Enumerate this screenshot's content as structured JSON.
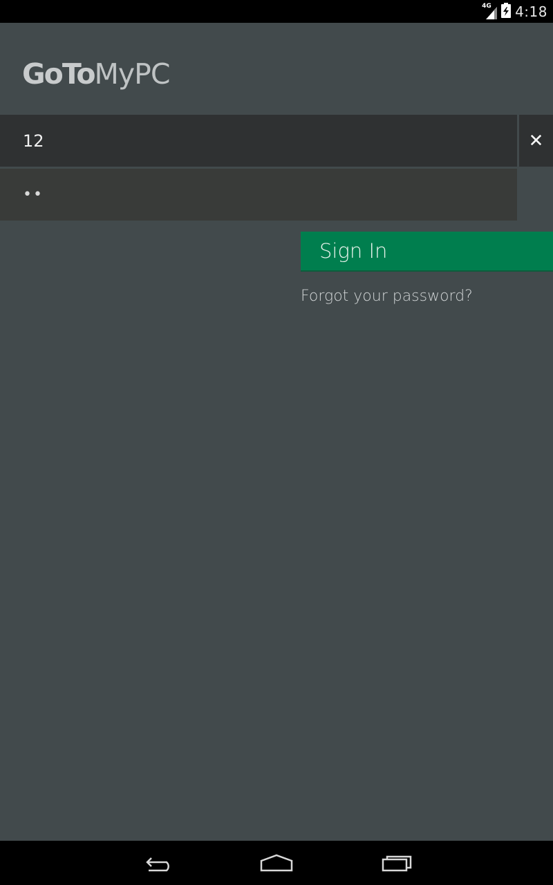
{
  "status_bar": {
    "network_label": "4G",
    "time": "4:18"
  },
  "logo": {
    "bold_part": "GoTo",
    "light_part": "MyPC"
  },
  "login": {
    "username_value": "12",
    "clear_symbol": "✕",
    "password_masked": "••",
    "signin_label": "Sign In",
    "forgot_label": "Forgot your password?"
  },
  "colors": {
    "background": "#424a4c",
    "field_dark": "#2f3132",
    "field_password": "#393b39",
    "accent_green": "#007e4e"
  },
  "nav_icons": [
    "back-icon",
    "home-icon",
    "recents-icon"
  ]
}
